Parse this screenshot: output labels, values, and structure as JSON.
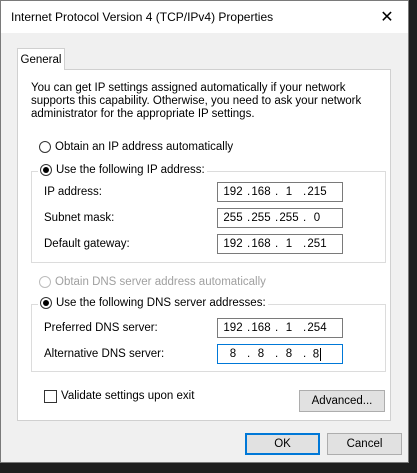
{
  "window": {
    "title": "Internet Protocol Version 4 (TCP/IPv4) Properties"
  },
  "tabs": [
    {
      "label": "General"
    }
  ],
  "description": "You can get IP settings assigned automatically if your network supports this capability. Otherwise, you need to ask your network administrator for the appropriate IP settings.",
  "ip": {
    "auto_label": "Obtain an IP address automatically",
    "manual_label": "Use the following IP address:",
    "auto_selected": false,
    "fields": [
      {
        "label": "IP address:",
        "octets": [
          "192",
          "168",
          "1",
          "215"
        ]
      },
      {
        "label": "Subnet mask:",
        "octets": [
          "255",
          "255",
          "255",
          "0"
        ]
      },
      {
        "label": "Default gateway:",
        "octets": [
          "192",
          "168",
          "1",
          "251"
        ]
      }
    ]
  },
  "dns": {
    "auto_label": "Obtain DNS server address automatically",
    "manual_label": "Use the following DNS server addresses:",
    "auto_enabled": false,
    "fields": [
      {
        "label": "Preferred DNS server:",
        "octets": [
          "192",
          "168",
          "1",
          "254"
        ]
      },
      {
        "label": "Alternative DNS server:",
        "octets": [
          "8",
          "8",
          "8",
          "8"
        ]
      }
    ]
  },
  "validate": {
    "label": "Validate settings upon exit",
    "checked": false
  },
  "buttons": {
    "advanced": "Advanced...",
    "ok": "OK",
    "cancel": "Cancel"
  },
  "icons": {
    "close": "close-icon"
  }
}
